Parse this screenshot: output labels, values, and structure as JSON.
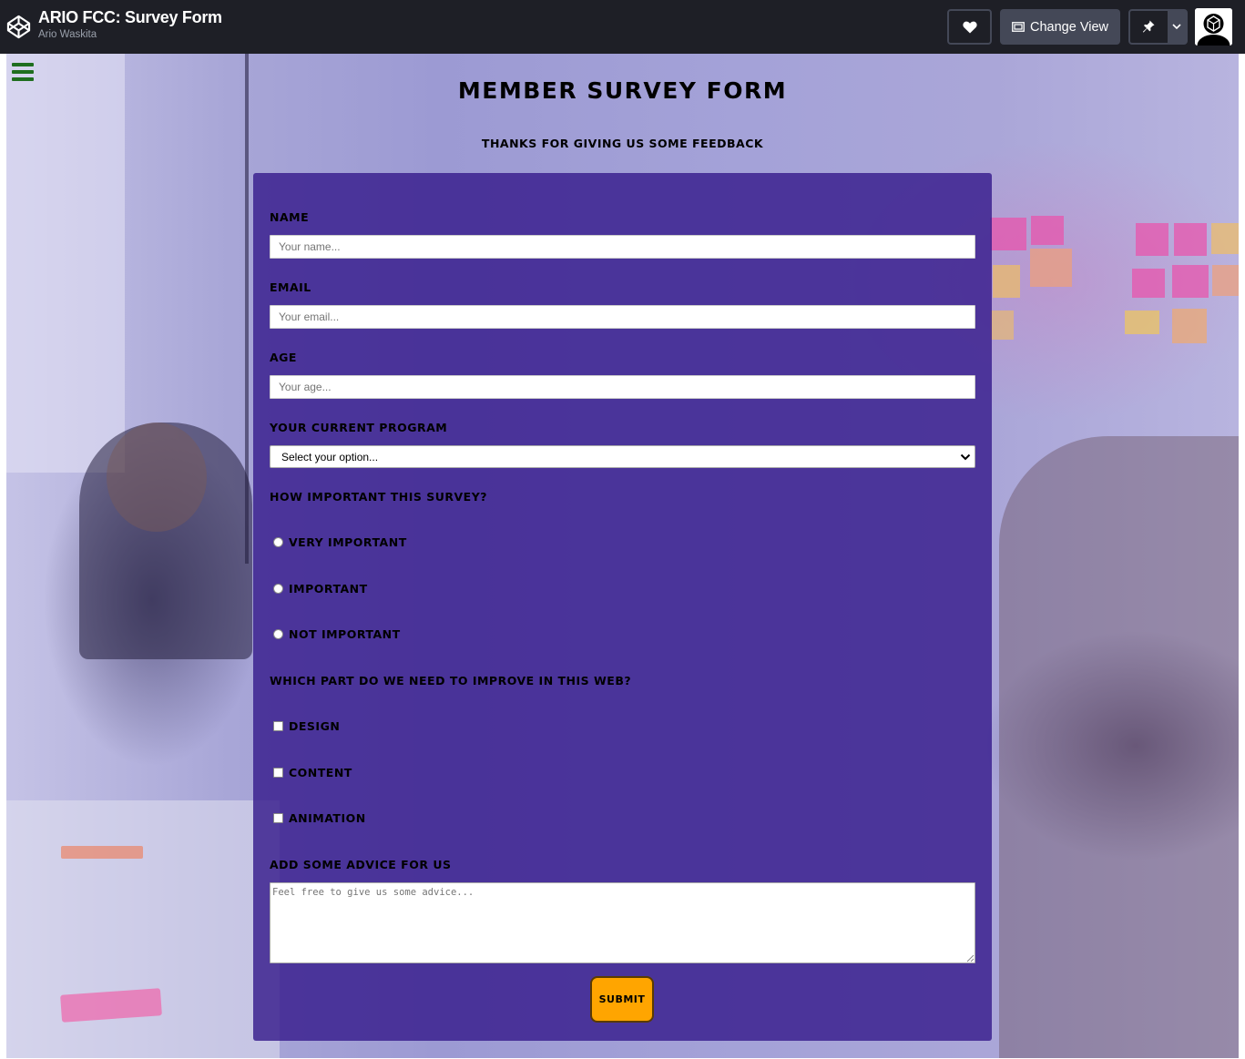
{
  "header": {
    "title": "ARIO FCC: Survey Form",
    "author": "Ario Waskita",
    "change_view_label": "Change View",
    "icons": {
      "logo": "codepen-logo-icon",
      "heart": "heart-icon",
      "change_view": "layout-icon",
      "pin": "pin-icon",
      "dropdown": "chevron-down-icon",
      "avatar": "user-avatar"
    }
  },
  "survey": {
    "title": "Member Survey Form",
    "subtitle": "Thanks for giving us some feedback",
    "fields": {
      "name": {
        "label": "Name",
        "placeholder": "Your name..."
      },
      "email": {
        "label": "Email",
        "placeholder": "Your email..."
      },
      "age": {
        "label": "Age",
        "placeholder": "Your age..."
      },
      "program": {
        "label": "Your current program",
        "selected": "Select your option..."
      }
    },
    "importance": {
      "question": "How important this survey?",
      "options": [
        "Very important",
        "Important",
        "Not important"
      ]
    },
    "improve": {
      "question": "Which part do we need to improve in this web?",
      "options": [
        "Design",
        "Content",
        "Animation"
      ]
    },
    "advice": {
      "label": "Add some advice for us",
      "placeholder": "Feel free to give us some advice..."
    },
    "submit_label": "Submit"
  },
  "colors": {
    "topbar": "#1e1f26",
    "panel": "#371c8c",
    "submit": "#ffa500",
    "hamburger": "#1f6e1f"
  }
}
